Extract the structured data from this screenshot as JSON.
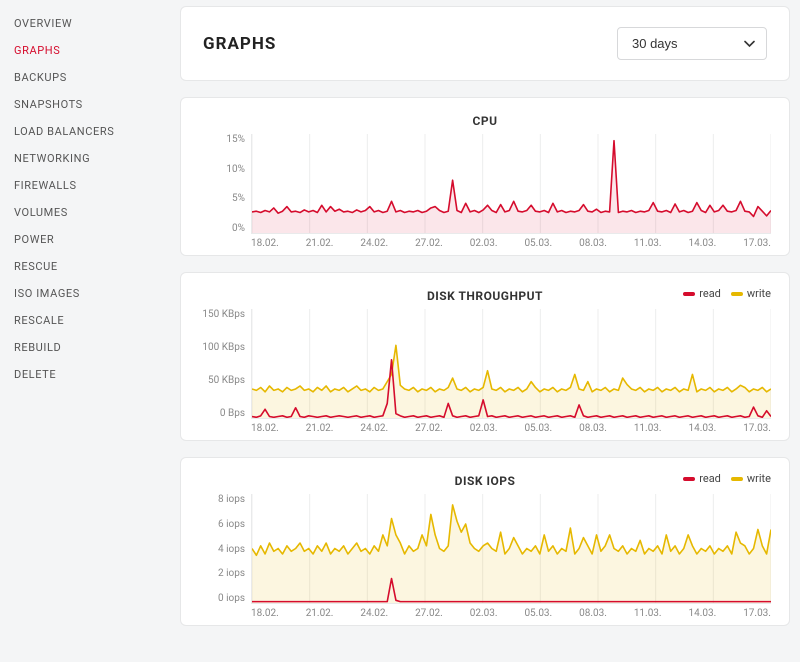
{
  "sidebar": {
    "items": [
      {
        "label": "OVERVIEW",
        "active": false
      },
      {
        "label": "GRAPHS",
        "active": true
      },
      {
        "label": "BACKUPS",
        "active": false
      },
      {
        "label": "SNAPSHOTS",
        "active": false
      },
      {
        "label": "LOAD BALANCERS",
        "active": false
      },
      {
        "label": "NETWORKING",
        "active": false
      },
      {
        "label": "FIREWALLS",
        "active": false
      },
      {
        "label": "VOLUMES",
        "active": false
      },
      {
        "label": "POWER",
        "active": false
      },
      {
        "label": "RESCUE",
        "active": false
      },
      {
        "label": "ISO IMAGES",
        "active": false
      },
      {
        "label": "RESCALE",
        "active": false
      },
      {
        "label": "REBUILD",
        "active": false
      },
      {
        "label": "DELETE",
        "active": false
      }
    ]
  },
  "header": {
    "title": "GRAPHS",
    "range_selected": "30 days"
  },
  "colors": {
    "red": "#d50c2d",
    "red_fill": "rgba(213,12,45,0.10)",
    "yellow": "#e6b800",
    "yellow_fill": "rgba(230,184,0,0.12)"
  },
  "chart_data": [
    {
      "id": "cpu",
      "type": "area",
      "title": "CPU",
      "ylabel": "",
      "ylim": [
        0,
        15
      ],
      "y_ticks": [
        "15%",
        "10%",
        "5%",
        "0%"
      ],
      "x_ticks": [
        "18.02.",
        "21.02.",
        "24.02.",
        "27.02.",
        "02.03.",
        "05.03.",
        "08.03.",
        "11.03.",
        "14.03.",
        "17.03."
      ],
      "series": [
        {
          "name": "cpu",
          "color": "red",
          "fill": "red_fill",
          "values": [
            3.2,
            3.3,
            3.1,
            3.4,
            3.2,
            3.8,
            3.0,
            3.3,
            4.0,
            3.2,
            3.3,
            3.1,
            3.5,
            3.2,
            3.4,
            3.1,
            4.2,
            3.2,
            4.0,
            3.3,
            3.6,
            3.2,
            3.3,
            3.1,
            3.5,
            3.2,
            3.4,
            4.0,
            3.2,
            3.4,
            3.1,
            3.3,
            4.8,
            3.2,
            3.4,
            3.1,
            3.3,
            3.2,
            3.4,
            3.1,
            3.3,
            3.8,
            4.0,
            3.4,
            3.1,
            3.3,
            8.0,
            3.4,
            3.1,
            4.5,
            3.2,
            3.4,
            3.1,
            3.5,
            4.2,
            3.4,
            3.1,
            4.3,
            3.2,
            3.4,
            4.8,
            3.3,
            3.2,
            3.4,
            4.2,
            3.3,
            3.2,
            3.4,
            3.1,
            4.5,
            3.2,
            3.4,
            3.1,
            3.3,
            3.2,
            3.4,
            4.3,
            3.3,
            3.2,
            3.6,
            3.1,
            3.3,
            3.2,
            14.0,
            3.1,
            3.3,
            3.2,
            3.4,
            3.1,
            3.3,
            3.2,
            3.4,
            4.6,
            3.3,
            3.2,
            3.4,
            3.1,
            4.4,
            3.2,
            3.4,
            3.1,
            3.3,
            4.6,
            3.4,
            3.1,
            4.2,
            3.2,
            3.4,
            4.2,
            3.3,
            3.2,
            3.4,
            4.8,
            3.3,
            3.2,
            2.5,
            4.0,
            3.3,
            2.6,
            3.4
          ]
        }
      ],
      "height": 100
    },
    {
      "id": "disk-throughput",
      "type": "line",
      "title": "DISK THROUGHPUT",
      "ylabel": "",
      "ylim": [
        0,
        150
      ],
      "y_ticks": [
        "150 KBps",
        "100 KBps",
        "50 KBps",
        "0 Bps"
      ],
      "x_ticks": [
        "18.02.",
        "21.02.",
        "24.02.",
        "27.02.",
        "02.03.",
        "05.03.",
        "08.03.",
        "11.03.",
        "14.03.",
        "17.03."
      ],
      "legend": [
        {
          "name": "read",
          "color": "red"
        },
        {
          "name": "write",
          "color": "yellow"
        }
      ],
      "series": [
        {
          "name": "write",
          "color": "yellow",
          "fill": "yellow_fill",
          "values": [
            40,
            38,
            42,
            36,
            44,
            38,
            40,
            36,
            42,
            38,
            40,
            44,
            38,
            40,
            36,
            42,
            38,
            44,
            36,
            40,
            38,
            42,
            36,
            40,
            44,
            38,
            40,
            36,
            42,
            38,
            40,
            50,
            60,
            100,
            45,
            40,
            38,
            42,
            36,
            40,
            38,
            42,
            36,
            40,
            38,
            42,
            55,
            40,
            38,
            42,
            36,
            40,
            38,
            42,
            65,
            40,
            38,
            42,
            36,
            40,
            38,
            42,
            36,
            40,
            50,
            42,
            36,
            40,
            38,
            42,
            36,
            40,
            38,
            42,
            60,
            40,
            38,
            50,
            36,
            40,
            38,
            42,
            36,
            40,
            38,
            55,
            46,
            40,
            38,
            42,
            36,
            40,
            38,
            42,
            36,
            40,
            38,
            42,
            36,
            40,
            38,
            60,
            36,
            40,
            38,
            42,
            36,
            40,
            38,
            42,
            36,
            40,
            45,
            42,
            36,
            40,
            38,
            42,
            36,
            40
          ]
        },
        {
          "name": "read",
          "color": "red",
          "fill": null,
          "values": [
            2,
            1,
            3,
            12,
            2,
            1,
            2,
            3,
            1,
            2,
            14,
            2,
            1,
            3,
            2,
            1,
            2,
            3,
            1,
            2,
            3,
            2,
            1,
            2,
            3,
            1,
            2,
            3,
            1,
            2,
            3,
            20,
            80,
            6,
            3,
            1,
            2,
            3,
            1,
            2,
            3,
            1,
            2,
            3,
            1,
            20,
            3,
            1,
            2,
            3,
            1,
            2,
            3,
            25,
            2,
            3,
            1,
            2,
            3,
            1,
            2,
            3,
            1,
            2,
            3,
            1,
            2,
            3,
            1,
            2,
            3,
            1,
            2,
            3,
            1,
            18,
            3,
            1,
            2,
            3,
            1,
            2,
            3,
            1,
            2,
            3,
            1,
            2,
            3,
            1,
            2,
            3,
            1,
            2,
            3,
            1,
            2,
            3,
            1,
            2,
            3,
            1,
            2,
            3,
            1,
            2,
            3,
            1,
            2,
            3,
            1,
            2,
            3,
            1,
            2,
            15,
            3,
            1,
            10,
            2
          ]
        }
      ],
      "height": 110
    },
    {
      "id": "disk-iops",
      "type": "line",
      "title": "DISK IOPS",
      "ylabel": "",
      "ylim": [
        0,
        8
      ],
      "y_ticks": [
        "8 iops",
        "6 iops",
        "4 iops",
        "2 iops",
        "0 iops"
      ],
      "x_ticks": [
        "18.02.",
        "21.02.",
        "24.02.",
        "27.02.",
        "02.03.",
        "05.03.",
        "08.03.",
        "11.03.",
        "14.03.",
        "17.03."
      ],
      "legend": [
        {
          "name": "read",
          "color": "red"
        },
        {
          "name": "write",
          "color": "yellow"
        }
      ],
      "series": [
        {
          "name": "write",
          "color": "yellow",
          "fill": "yellow_fill",
          "values": [
            4.0,
            3.5,
            4.2,
            3.6,
            4.4,
            3.8,
            4.0,
            3.6,
            4.2,
            3.8,
            4.0,
            4.4,
            3.8,
            4.0,
            3.6,
            4.2,
            3.8,
            4.4,
            3.6,
            4.0,
            3.8,
            4.2,
            3.6,
            4.0,
            4.4,
            3.8,
            4.0,
            3.6,
            4.2,
            3.8,
            5.0,
            4.2,
            6.2,
            5.0,
            4.4,
            3.6,
            4.2,
            3.8,
            4.0,
            5.0,
            4.2,
            6.5,
            5.0,
            4.0,
            3.8,
            4.2,
            7.2,
            6.0,
            5.2,
            5.8,
            4.4,
            4.0,
            3.8,
            4.2,
            4.4,
            4.0,
            3.8,
            5.2,
            3.6,
            4.0,
            4.8,
            4.2,
            3.6,
            4.0,
            3.8,
            4.2,
            3.6,
            5.0,
            3.8,
            4.2,
            3.6,
            4.0,
            3.8,
            5.5,
            3.6,
            4.0,
            4.8,
            4.2,
            3.6,
            5.0,
            3.8,
            4.2,
            5.0,
            4.0,
            3.8,
            4.2,
            3.6,
            4.0,
            3.8,
            4.6,
            3.6,
            4.0,
            3.8,
            4.2,
            3.6,
            5.0,
            3.8,
            4.2,
            3.6,
            4.0,
            5.0,
            4.2,
            3.6,
            4.0,
            3.8,
            4.2,
            3.6,
            4.0,
            3.8,
            4.2,
            3.6,
            5.2,
            4.4,
            4.2,
            3.6,
            4.0,
            5.4,
            4.2,
            3.6,
            5.4
          ]
        },
        {
          "name": "read",
          "color": "red",
          "fill": null,
          "values": [
            0.1,
            0.1,
            0.1,
            0.1,
            0.1,
            0.1,
            0.1,
            0.1,
            0.1,
            0.1,
            0.1,
            0.1,
            0.1,
            0.1,
            0.1,
            0.1,
            0.1,
            0.1,
            0.1,
            0.1,
            0.1,
            0.1,
            0.1,
            0.1,
            0.1,
            0.1,
            0.1,
            0.1,
            0.1,
            0.1,
            0.1,
            0.1,
            1.8,
            0.2,
            0.1,
            0.1,
            0.1,
            0.1,
            0.1,
            0.1,
            0.1,
            0.1,
            0.1,
            0.1,
            0.1,
            0.1,
            0.1,
            0.1,
            0.1,
            0.1,
            0.1,
            0.1,
            0.1,
            0.1,
            0.1,
            0.1,
            0.1,
            0.1,
            0.1,
            0.1,
            0.1,
            0.1,
            0.1,
            0.1,
            0.1,
            0.1,
            0.1,
            0.1,
            0.1,
            0.1,
            0.1,
            0.1,
            0.1,
            0.1,
            0.1,
            0.1,
            0.1,
            0.1,
            0.1,
            0.1,
            0.1,
            0.1,
            0.1,
            0.1,
            0.1,
            0.1,
            0.1,
            0.1,
            0.1,
            0.1,
            0.1,
            0.1,
            0.1,
            0.1,
            0.1,
            0.1,
            0.1,
            0.1,
            0.1,
            0.1,
            0.1,
            0.1,
            0.1,
            0.1,
            0.1,
            0.1,
            0.1,
            0.1,
            0.1,
            0.1,
            0.1,
            0.1,
            0.1,
            0.1,
            0.1,
            0.1,
            0.1,
            0.1,
            0.1,
            0.1
          ]
        }
      ],
      "height": 110
    }
  ]
}
